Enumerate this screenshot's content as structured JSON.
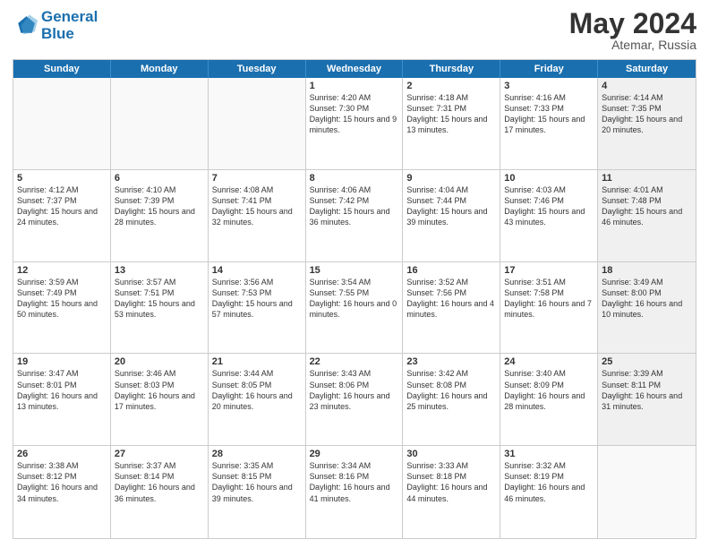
{
  "header": {
    "logo_line1": "General",
    "logo_line2": "Blue",
    "month_year": "May 2024",
    "location": "Atemar, Russia"
  },
  "weekdays": [
    "Sunday",
    "Monday",
    "Tuesday",
    "Wednesday",
    "Thursday",
    "Friday",
    "Saturday"
  ],
  "weeks": [
    [
      {
        "day": "",
        "info": "",
        "empty": true
      },
      {
        "day": "",
        "info": "",
        "empty": true
      },
      {
        "day": "",
        "info": "",
        "empty": true
      },
      {
        "day": "1",
        "info": "Sunrise: 4:20 AM\nSunset: 7:30 PM\nDaylight: 15 hours\nand 9 minutes."
      },
      {
        "day": "2",
        "info": "Sunrise: 4:18 AM\nSunset: 7:31 PM\nDaylight: 15 hours\nand 13 minutes."
      },
      {
        "day": "3",
        "info": "Sunrise: 4:16 AM\nSunset: 7:33 PM\nDaylight: 15 hours\nand 17 minutes."
      },
      {
        "day": "4",
        "info": "Sunrise: 4:14 AM\nSunset: 7:35 PM\nDaylight: 15 hours\nand 20 minutes.",
        "shaded": true
      }
    ],
    [
      {
        "day": "5",
        "info": "Sunrise: 4:12 AM\nSunset: 7:37 PM\nDaylight: 15 hours\nand 24 minutes."
      },
      {
        "day": "6",
        "info": "Sunrise: 4:10 AM\nSunset: 7:39 PM\nDaylight: 15 hours\nand 28 minutes."
      },
      {
        "day": "7",
        "info": "Sunrise: 4:08 AM\nSunset: 7:41 PM\nDaylight: 15 hours\nand 32 minutes."
      },
      {
        "day": "8",
        "info": "Sunrise: 4:06 AM\nSunset: 7:42 PM\nDaylight: 15 hours\nand 36 minutes."
      },
      {
        "day": "9",
        "info": "Sunrise: 4:04 AM\nSunset: 7:44 PM\nDaylight: 15 hours\nand 39 minutes."
      },
      {
        "day": "10",
        "info": "Sunrise: 4:03 AM\nSunset: 7:46 PM\nDaylight: 15 hours\nand 43 minutes."
      },
      {
        "day": "11",
        "info": "Sunrise: 4:01 AM\nSunset: 7:48 PM\nDaylight: 15 hours\nand 46 minutes.",
        "shaded": true
      }
    ],
    [
      {
        "day": "12",
        "info": "Sunrise: 3:59 AM\nSunset: 7:49 PM\nDaylight: 15 hours\nand 50 minutes."
      },
      {
        "day": "13",
        "info": "Sunrise: 3:57 AM\nSunset: 7:51 PM\nDaylight: 15 hours\nand 53 minutes."
      },
      {
        "day": "14",
        "info": "Sunrise: 3:56 AM\nSunset: 7:53 PM\nDaylight: 15 hours\nand 57 minutes."
      },
      {
        "day": "15",
        "info": "Sunrise: 3:54 AM\nSunset: 7:55 PM\nDaylight: 16 hours\nand 0 minutes."
      },
      {
        "day": "16",
        "info": "Sunrise: 3:52 AM\nSunset: 7:56 PM\nDaylight: 16 hours\nand 4 minutes."
      },
      {
        "day": "17",
        "info": "Sunrise: 3:51 AM\nSunset: 7:58 PM\nDaylight: 16 hours\nand 7 minutes."
      },
      {
        "day": "18",
        "info": "Sunrise: 3:49 AM\nSunset: 8:00 PM\nDaylight: 16 hours\nand 10 minutes.",
        "shaded": true
      }
    ],
    [
      {
        "day": "19",
        "info": "Sunrise: 3:47 AM\nSunset: 8:01 PM\nDaylight: 16 hours\nand 13 minutes."
      },
      {
        "day": "20",
        "info": "Sunrise: 3:46 AM\nSunset: 8:03 PM\nDaylight: 16 hours\nand 17 minutes."
      },
      {
        "day": "21",
        "info": "Sunrise: 3:44 AM\nSunset: 8:05 PM\nDaylight: 16 hours\nand 20 minutes."
      },
      {
        "day": "22",
        "info": "Sunrise: 3:43 AM\nSunset: 8:06 PM\nDaylight: 16 hours\nand 23 minutes."
      },
      {
        "day": "23",
        "info": "Sunrise: 3:42 AM\nSunset: 8:08 PM\nDaylight: 16 hours\nand 25 minutes."
      },
      {
        "day": "24",
        "info": "Sunrise: 3:40 AM\nSunset: 8:09 PM\nDaylight: 16 hours\nand 28 minutes."
      },
      {
        "day": "25",
        "info": "Sunrise: 3:39 AM\nSunset: 8:11 PM\nDaylight: 16 hours\nand 31 minutes.",
        "shaded": true
      }
    ],
    [
      {
        "day": "26",
        "info": "Sunrise: 3:38 AM\nSunset: 8:12 PM\nDaylight: 16 hours\nand 34 minutes."
      },
      {
        "day": "27",
        "info": "Sunrise: 3:37 AM\nSunset: 8:14 PM\nDaylight: 16 hours\nand 36 minutes."
      },
      {
        "day": "28",
        "info": "Sunrise: 3:35 AM\nSunset: 8:15 PM\nDaylight: 16 hours\nand 39 minutes."
      },
      {
        "day": "29",
        "info": "Sunrise: 3:34 AM\nSunset: 8:16 PM\nDaylight: 16 hours\nand 41 minutes."
      },
      {
        "day": "30",
        "info": "Sunrise: 3:33 AM\nSunset: 8:18 PM\nDaylight: 16 hours\nand 44 minutes."
      },
      {
        "day": "31",
        "info": "Sunrise: 3:32 AM\nSunset: 8:19 PM\nDaylight: 16 hours\nand 46 minutes."
      },
      {
        "day": "",
        "info": "",
        "empty": true,
        "shaded": true
      }
    ]
  ]
}
